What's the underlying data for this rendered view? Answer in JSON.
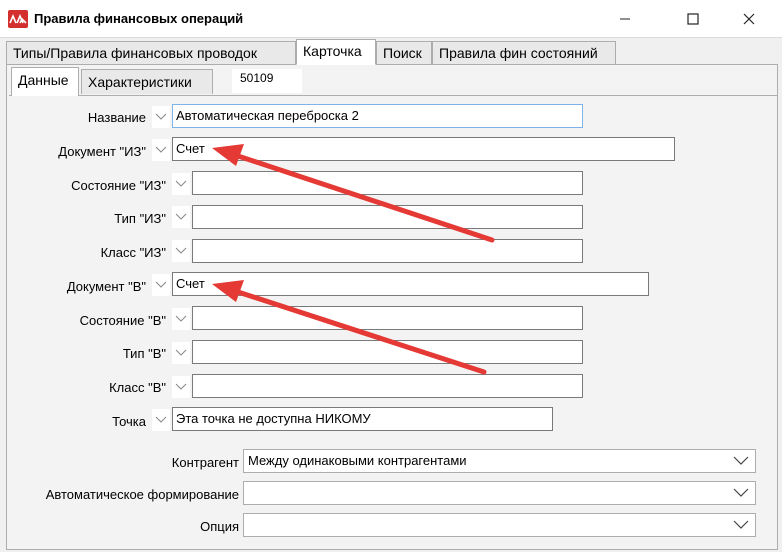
{
  "window": {
    "title": "Правила финансовых операций",
    "minimize": "–",
    "maximize": "□",
    "close": "✕"
  },
  "tabs": [
    {
      "label": "Типы/Правила финансовых проводок",
      "active": false
    },
    {
      "label": "Карточка",
      "active": true
    },
    {
      "label": "Поиск",
      "active": false
    },
    {
      "label": "Правила фин состояний",
      "active": false
    }
  ],
  "subtabs": [
    {
      "label": "Данные",
      "active": true
    },
    {
      "label": "Характеристики",
      "active": false
    }
  ],
  "record_code": "50109",
  "fields": {
    "name": {
      "label": "Название",
      "value": "Автоматическая переброска 2"
    },
    "doc_from": {
      "label": "Документ \"ИЗ\"",
      "value": "Счет"
    },
    "state_from": {
      "label": "Состояние \"ИЗ\"",
      "value": ""
    },
    "type_from": {
      "label": "Тип \"ИЗ\"",
      "value": ""
    },
    "class_from": {
      "label": "Класс \"ИЗ\"",
      "value": ""
    },
    "doc_to": {
      "label": "Документ \"В\"",
      "value": "Счет"
    },
    "state_to": {
      "label": "Состояние \"В\"",
      "value": ""
    },
    "type_to": {
      "label": "Тип \"В\"",
      "value": ""
    },
    "class_to": {
      "label": "Класс \"В\"",
      "value": ""
    },
    "point": {
      "label": "Точка",
      "value": "Эта точка не доступна НИКОМУ"
    }
  },
  "combos": {
    "counterparty": {
      "label": "Контрагент",
      "value": "Между одинаковыми контрагентами"
    },
    "auto_form": {
      "label": "Автоматическое формирование",
      "value": ""
    },
    "option": {
      "label": "Опция",
      "value": ""
    }
  },
  "colors": {
    "annotation_arrow": "#e53935",
    "active_field_border": "#7eb4ea",
    "app_icon": "#d32f2f"
  }
}
